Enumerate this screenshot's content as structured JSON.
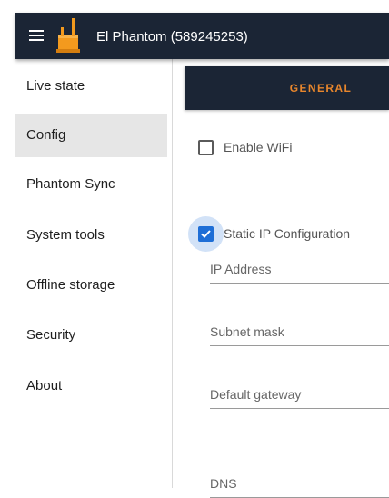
{
  "header": {
    "title": "El Phantom (589245253)",
    "menu_icon": "hamburger-menu-icon",
    "logo_icon": "phantom-device-logo-icon"
  },
  "sidebar": {
    "items": [
      {
        "label": "Live state",
        "active": false
      },
      {
        "label": "Config",
        "active": true
      },
      {
        "label": "Phantom Sync",
        "active": false
      },
      {
        "label": "System tools",
        "active": false
      },
      {
        "label": "Offline storage",
        "active": false
      },
      {
        "label": "Security",
        "active": false
      },
      {
        "label": "About",
        "active": false
      }
    ]
  },
  "tabs": [
    {
      "label": "GENERAL",
      "active": true
    }
  ],
  "form": {
    "enable_wifi": {
      "label": "Enable WiFi",
      "checked": false
    },
    "static_ip": {
      "label": "Static IP Configuration",
      "checked": true
    },
    "fields": [
      {
        "placeholder": "IP Address",
        "value": ""
      },
      {
        "placeholder": "Subnet mask",
        "value": ""
      },
      {
        "placeholder": "Default gateway",
        "value": ""
      },
      {
        "placeholder": "DNS",
        "value": ""
      }
    ]
  },
  "colors": {
    "header_bg": "#1b2535",
    "tab_accent": "#e8862c",
    "checkbox_checked": "#1f6fd6",
    "sidebar_active_bg": "#e6e6e6"
  }
}
